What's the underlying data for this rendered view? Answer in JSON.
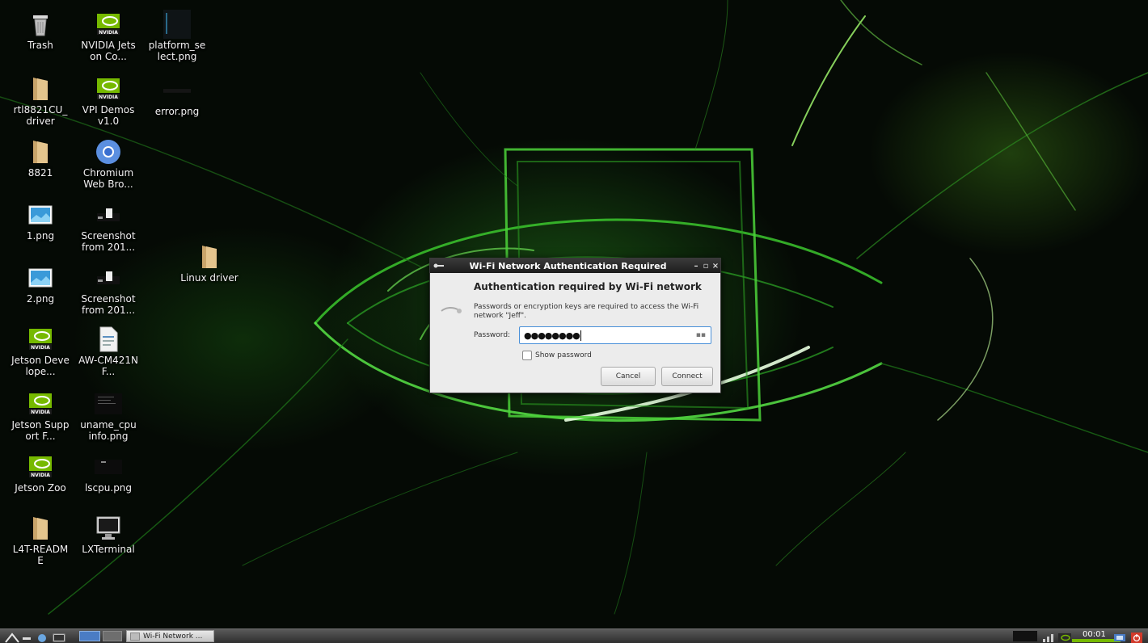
{
  "desktop": {
    "icons": [
      {
        "label": "Trash",
        "icon": "trash-icon"
      },
      {
        "label": "NVIDIA Jetson Co...",
        "icon": "nvidia-icon"
      },
      {
        "label": "platform_se lect.png",
        "icon": "image-thumbnail-icon"
      },
      {
        "label": "rtl8821CU_ driver",
        "icon": "folder-icon"
      },
      {
        "label": "VPI Demos v1.0",
        "icon": "nvidia-icon"
      },
      {
        "label": "error.png",
        "icon": "image-thumbnail-icon"
      },
      {
        "label": "8821",
        "icon": "folder-icon"
      },
      {
        "label": "Chromium Web Bro...",
        "icon": "chromium-icon"
      },
      {
        "label": "1.png",
        "icon": "image-icon"
      },
      {
        "label": "Screenshot from 201...",
        "icon": "screenshot-icon"
      },
      {
        "label": "Linux driver",
        "icon": "folder-icon"
      },
      {
        "label": "2.png",
        "icon": "image-icon"
      },
      {
        "label": "Screenshot from 201...",
        "icon": "screenshot-icon"
      },
      {
        "label": "Jetson Develope...",
        "icon": "nvidia-icon"
      },
      {
        "label": "AW-CM421NF...",
        "icon": "document-icon"
      },
      {
        "label": "Jetson Support F...",
        "icon": "nvidia-icon"
      },
      {
        "label": "uname_cpu info.png",
        "icon": "image-thumbnail-icon"
      },
      {
        "label": "Jetson Zoo",
        "icon": "nvidia-icon"
      },
      {
        "label": "lscpu.png",
        "icon": "image-thumbnail-icon"
      },
      {
        "label": "L4T-README",
        "icon": "folder-icon"
      },
      {
        "label": "LXTerminal",
        "icon": "terminal-icon"
      }
    ]
  },
  "dialog": {
    "title": "Wi-Fi Network Authentication Required",
    "heading": "Authentication required by Wi-Fi network",
    "description": "Passwords or encryption keys are required to access the Wi-Fi network \"Jeff\".",
    "password_label": "Password:",
    "password_value": "●●●●●●●●",
    "show_password_label": "Show password",
    "show_password_checked": false,
    "cancel_label": "Cancel",
    "connect_label": "Connect"
  },
  "taskbar": {
    "task_label": "Wi-Fi Network ...",
    "clock": "00:01"
  },
  "colors": {
    "accent_green": "#76b900",
    "focus_blue": "#4a90d9",
    "power_red": "#d23a2a"
  }
}
